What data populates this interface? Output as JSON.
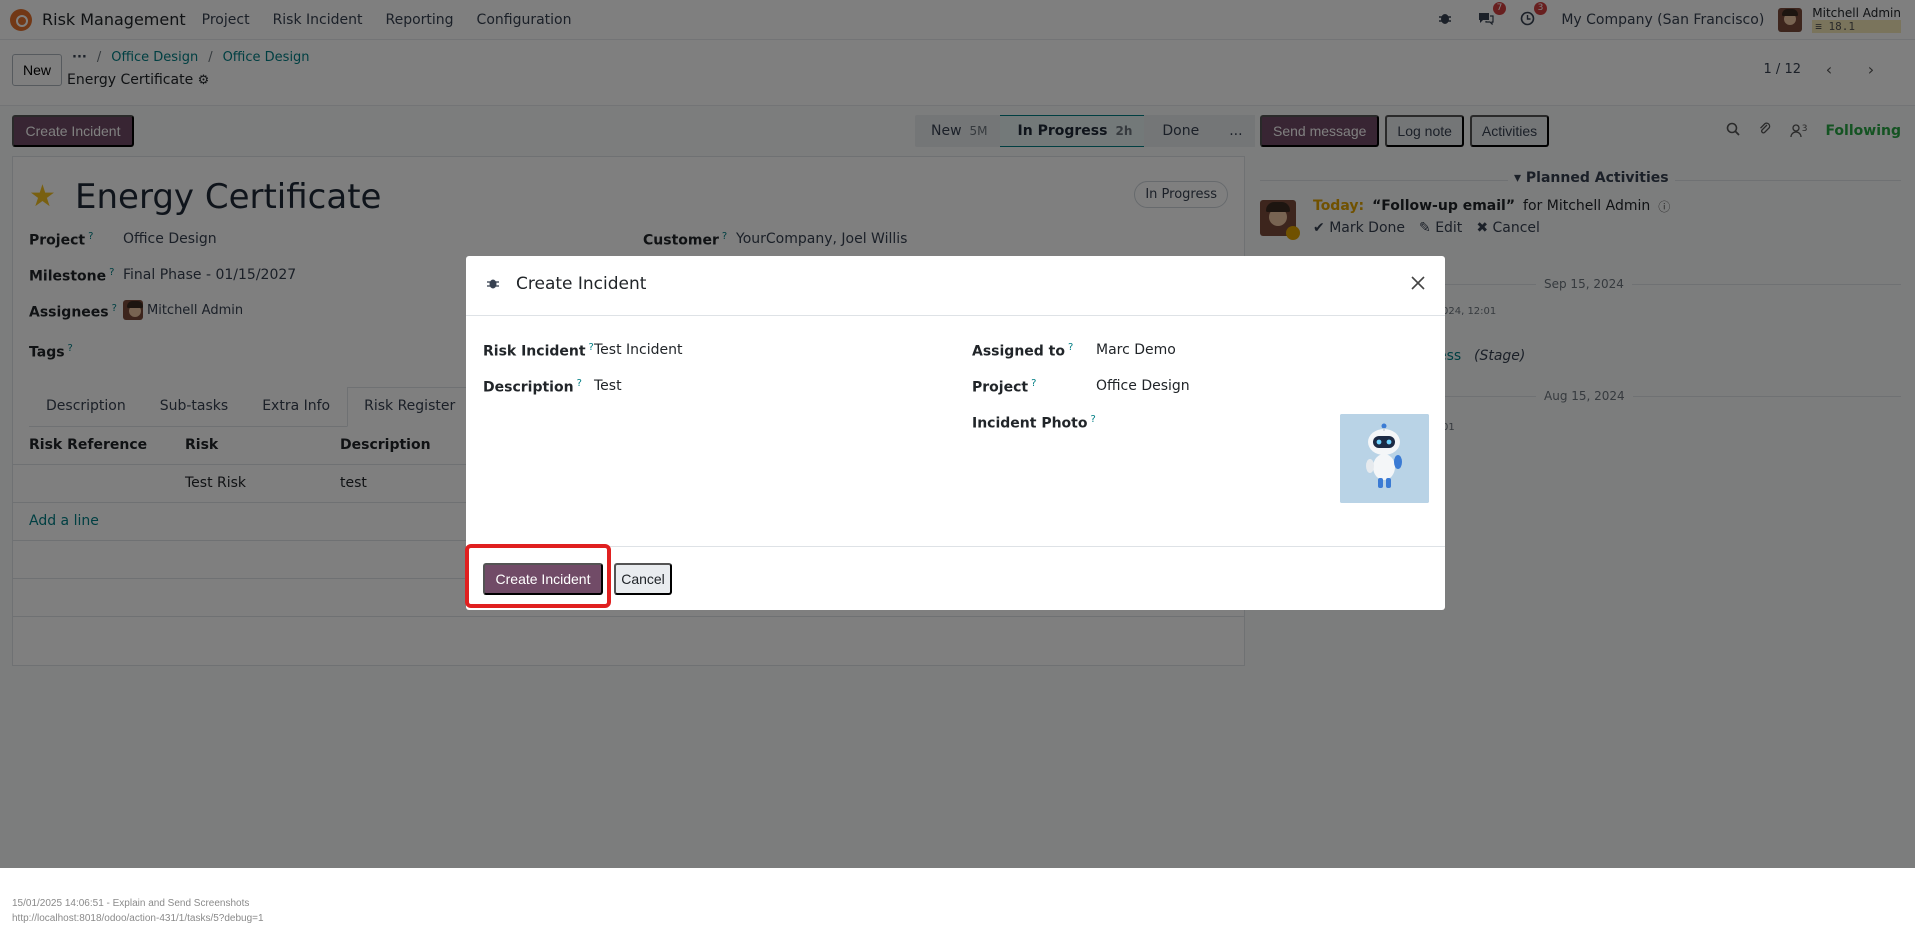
{
  "navbar": {
    "app_name": "Risk Management",
    "menu": [
      "Project",
      "Risk Incident",
      "Reporting",
      "Configuration"
    ],
    "chat_badge": "7",
    "activity_badge": "3",
    "company": "My Company (San Francisco)",
    "user_name": "Mitchell Admin",
    "db_version": "18.1"
  },
  "control_panel": {
    "new_label": "New",
    "breadcrumb_more": "···",
    "breadcrumbs": [
      "Office Design",
      "Office Design"
    ],
    "record_title": "Energy Certificate",
    "pager": "1 / 12"
  },
  "statusbar": {
    "create_incident_label": "Create Incident",
    "stages": [
      {
        "label": "New",
        "duration": "5M"
      },
      {
        "label": "In Progress",
        "duration": "2h"
      },
      {
        "label": "Done",
        "duration": ""
      },
      {
        "label": "...",
        "duration": ""
      }
    ]
  },
  "form": {
    "title": "Energy Certificate",
    "status_badge": "In Progress",
    "fields": {
      "project_label": "Project",
      "project_value": "Office Design",
      "customer_label": "Customer",
      "customer_value": "YourCompany, Joel Willis",
      "milestone_label": "Milestone",
      "milestone_value": "Final Phase - 01/15/2027",
      "assignees_label": "Assignees",
      "assignees_value": "Mitchell Admin",
      "tags_label": "Tags"
    },
    "help_mark": "?",
    "tabs": [
      "Description",
      "Sub-tasks",
      "Extra Info",
      "Risk Register"
    ],
    "table": {
      "headers": [
        "Risk Reference",
        "Risk",
        "Description"
      ],
      "rows": [
        [
          "",
          "Test Risk",
          "test"
        ]
      ],
      "add_line": "Add a line"
    }
  },
  "chatter": {
    "send_message": "Send message",
    "log_note": "Log note",
    "activities": "Activities",
    "followers_count": "3",
    "following": "Following",
    "planned_activities": "Planned Activities",
    "activity": {
      "when": "Today:",
      "summary": "“Follow-up email”",
      "for_text": "for Mitchell Admin",
      "mark_done": "Mark Done",
      "edit": "Edit",
      "cancel": "Cancel"
    },
    "date_1": "Sep 15, 2024",
    "date_2": "Aug 15, 2024",
    "frag_time_1": "024, 12:01",
    "frag_stage_value": "ess",
    "frag_stage_label": "(Stage)",
    "frag_time_2": "01"
  },
  "modal": {
    "title": "Create Incident",
    "risk_incident_label": "Risk Incident",
    "risk_incident_value": "Test Incident",
    "description_label": "Description",
    "description_value": "Test",
    "assigned_to_label": "Assigned to",
    "assigned_to_value": "Marc Demo",
    "project_label": "Project",
    "project_value": "Office Design",
    "incident_photo_label": "Incident Photo",
    "create_button": "Create Incident",
    "cancel_button": "Cancel"
  },
  "footer": {
    "line1": "15/01/2025 14:06:51 - Explain and Send Screenshots",
    "line2": "http://localhost:8018/odoo/action-431/1/tasks/5?debug=1"
  },
  "colors": {
    "primary": "#714b67",
    "link": "#017e84",
    "highlight": "#e02020",
    "following": "#28a745"
  }
}
